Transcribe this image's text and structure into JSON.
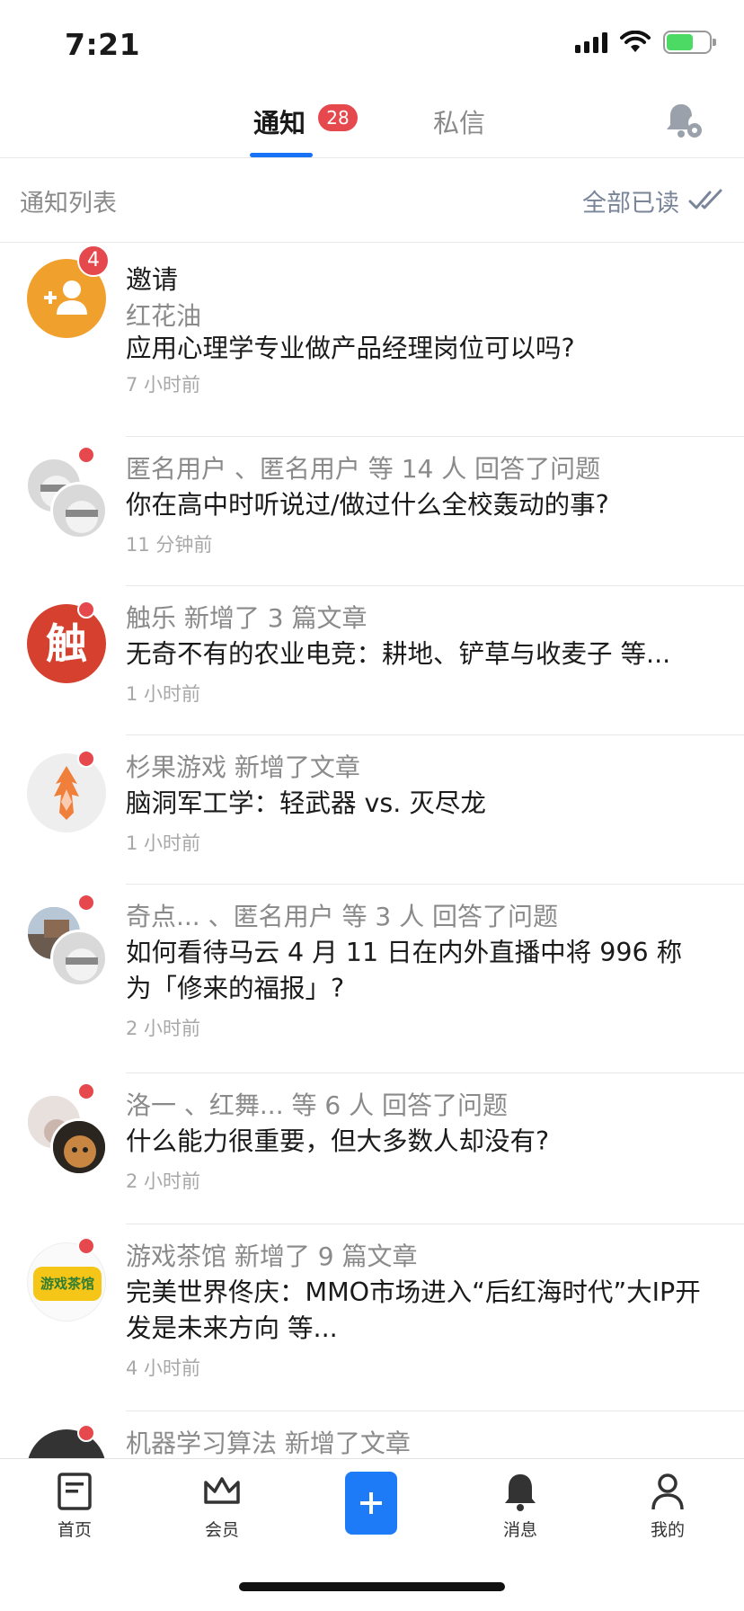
{
  "status_bar": {
    "time": "7:21"
  },
  "tabs": {
    "notice_label": "通知",
    "notice_badge": "28",
    "message_label": "私信"
  },
  "list_header": {
    "title": "通知列表",
    "mark_all_read": "全部已读"
  },
  "notifications": [
    {
      "title": "邀请",
      "sub": "红花油",
      "body": "应用心理学专业做产品经理岗位可以吗?",
      "time": "7 小时前",
      "badge": "4",
      "avatar_icon": "add-user-icon"
    },
    {
      "head": "匿名用户 、匿名用户 等 14 人 回答了问题",
      "body": "你在高中时听说过/做过什么全校轰动的事?",
      "time": "11 分钟前"
    },
    {
      "head": "触乐 新增了 3 篇文章",
      "body": "无奇不有的农业电竞：耕地、铲草与收麦子 等...",
      "time": "1 小时前",
      "avatar_text": "触"
    },
    {
      "head": "杉果游戏 新增了文章",
      "body": "脑洞军工学：轻武器 vs. 灭尽龙",
      "time": "1 小时前"
    },
    {
      "head": "奇点... 、匿名用户 等 3 人 回答了问题",
      "body": "如何看待马云 4 月 11 日在内外直播中将 996 称为「修来的福报」?",
      "time": "2 小时前"
    },
    {
      "head": "洛一 、红舞... 等 6 人 回答了问题",
      "body": "什么能力很重要，但大多数人却没有?",
      "time": "2 小时前"
    },
    {
      "head": "游戏茶馆 新增了 9 篇文章",
      "body": "完美世界佟庆：MMO市场进入“后红海时代”大IP开发是未来方向 等...",
      "time": "4 小时前",
      "avatar_text": "游戏茶馆"
    },
    {
      "head": "机器学习算法 新增了文章"
    }
  ],
  "bottom_nav": {
    "home": "首页",
    "vip": "会员",
    "messages": "消息",
    "me": "我的"
  },
  "colors": {
    "accent": "#1772f6",
    "badge_red": "#e5484d",
    "text_gray": "#8a8a8a"
  }
}
